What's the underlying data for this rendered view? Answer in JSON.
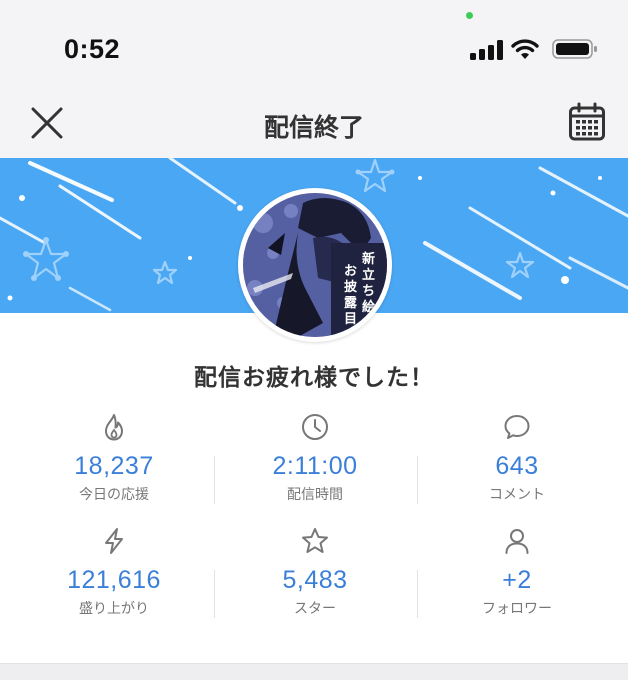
{
  "status_bar": {
    "time": "0:52"
  },
  "header": {
    "title": "配信終了",
    "close_icon": "close-icon",
    "calendar_icon": "calendar-icon"
  },
  "avatar": {
    "poster_text_line1": "新立ち絵",
    "poster_text_line2": "お披露目"
  },
  "headline": "配信お疲れ様でした！",
  "stats": [
    {
      "icon": "fire-icon",
      "value": "18,237",
      "label": "今日の応援"
    },
    {
      "icon": "clock-icon",
      "value": "2:11:00",
      "label": "配信時間"
    },
    {
      "icon": "comment-icon",
      "value": "643",
      "label": "コメント"
    },
    {
      "icon": "lightning-icon",
      "value": "121,616",
      "label": "盛り上がり"
    },
    {
      "icon": "star-icon",
      "value": "5,483",
      "label": "スター"
    },
    {
      "icon": "person-icon",
      "value": "+2",
      "label": "フォロワー"
    }
  ],
  "colors": {
    "banner": "#4aa7f3",
    "value_blue": "#3b7fd9",
    "background": "#f4f4f7"
  }
}
